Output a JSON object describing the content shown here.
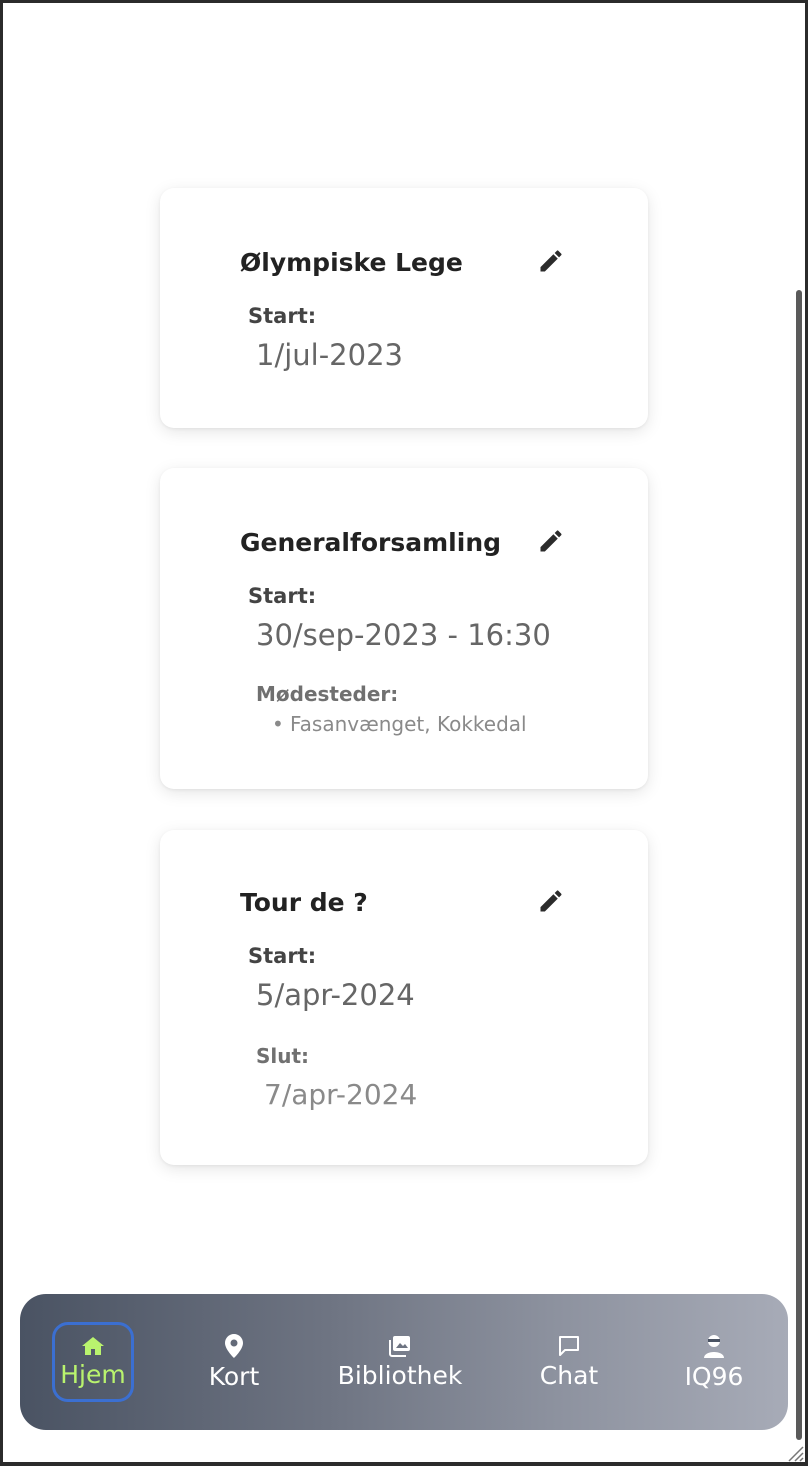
{
  "events": [
    {
      "title": "Ølympiske Lege",
      "start_label": "Start:",
      "start_value": "1/jul-2023"
    },
    {
      "title": "Generalforsamling",
      "start_label": "Start:",
      "start_value": "30/sep-2023 - 16:30",
      "locations_label": "Mødesteder:",
      "locations": [
        "Fasanvænget, Kokkedal"
      ]
    },
    {
      "title": "Tour de ?",
      "start_label": "Start:",
      "start_value": "5/apr-2024",
      "end_label": "Slut:",
      "end_value": "7/apr-2024"
    }
  ],
  "nav": {
    "items": [
      {
        "label": "Hjem",
        "icon": "home-icon",
        "active": true
      },
      {
        "label": "Kort",
        "icon": "map-pin-icon",
        "active": false
      },
      {
        "label": "Bibliothek",
        "icon": "image-gallery-icon",
        "active": false
      },
      {
        "label": "Chat",
        "icon": "chat-bubble-icon",
        "active": false
      },
      {
        "label": "IQ96",
        "icon": "user-incognito-icon",
        "active": false
      }
    ]
  },
  "colors": {
    "active_nav_text": "#b9f36e",
    "active_nav_border": "#3b6fd1",
    "nav_gradient_start": "#4a5363",
    "nav_gradient_end": "#a7abb7"
  }
}
